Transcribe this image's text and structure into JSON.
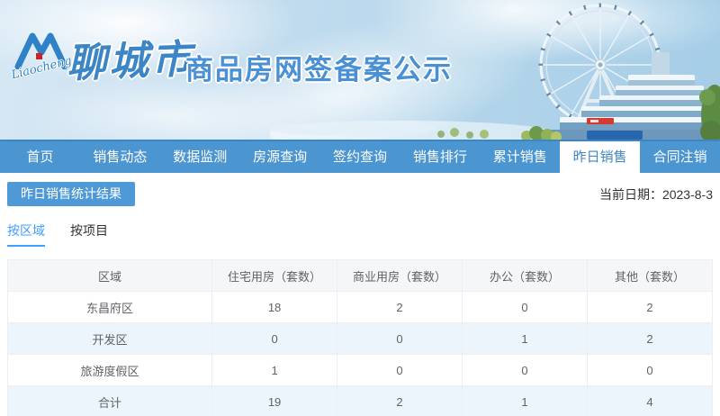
{
  "banner": {
    "logo_script": "Liaocheng",
    "city_name": "聊城市",
    "site_title": "商品房网签备案公示"
  },
  "nav": {
    "active_index": 7,
    "items": [
      {
        "label": "首页",
        "active": false
      },
      {
        "label": "销售动态",
        "active": false
      },
      {
        "label": "数据监测",
        "active": false
      },
      {
        "label": "房源查询",
        "active": false
      },
      {
        "label": "签约查询",
        "active": false
      },
      {
        "label": "销售排行",
        "active": false
      },
      {
        "label": "累计销售",
        "active": false
      },
      {
        "label": "昨日销售",
        "active": true
      },
      {
        "label": "合同注销",
        "active": false
      }
    ]
  },
  "content": {
    "section_title": "昨日销售统计结果",
    "current_date": "当前日期：2023-8-3",
    "tabs": [
      {
        "label": "按区域",
        "active": true
      },
      {
        "label": "按项目",
        "active": false
      }
    ]
  },
  "table": {
    "headers": [
      "区域",
      "住宅用房（套数）",
      "商业用房（套数）",
      "办公（套数）",
      "其他（套数）"
    ],
    "rows": [
      [
        "东昌府区",
        "18",
        "2",
        "0",
        "2"
      ],
      [
        "开发区",
        "0",
        "0",
        "1",
        "2"
      ],
      [
        "旅游度假区",
        "1",
        "0",
        "0",
        "0"
      ],
      [
        "合计",
        "19",
        "2",
        "1",
        "4"
      ]
    ]
  },
  "colors": {
    "nav_blue": "#4B95D1",
    "active_nav_text": "#3E86C6",
    "badge_blue": "#4F9AD6",
    "tab_active_blue": "#409EFF",
    "banner_title_blue": "#4A90D5",
    "table_border": "#EBEEF5",
    "table_header_bg": "#F5F6F8",
    "table_cell_text": "#606266",
    "striped_row_bg": "#EDF5FC",
    "logo_red": "#CC2222"
  }
}
